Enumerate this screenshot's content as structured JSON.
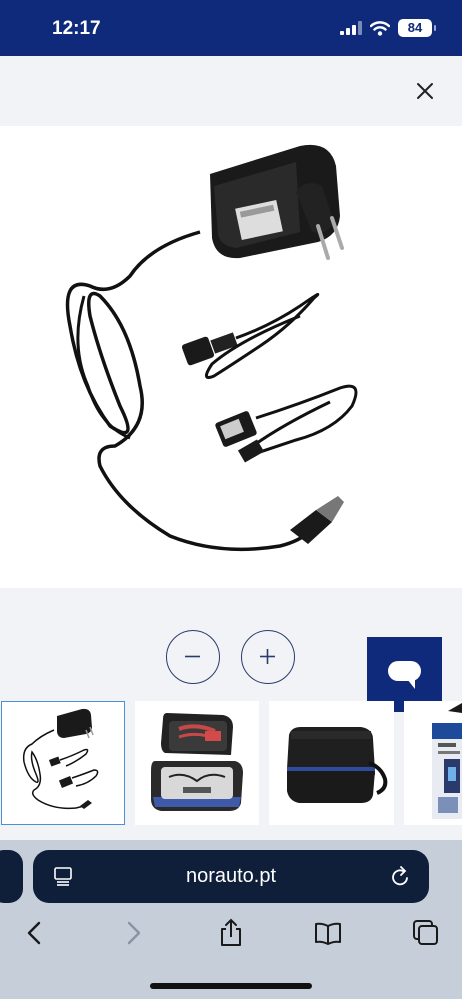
{
  "status_bar": {
    "time": "12:17",
    "battery": "84",
    "icons": [
      "signal-icon",
      "wifi-icon",
      "battery-icon"
    ]
  },
  "modal": {
    "close_icon": "close-icon",
    "zoom_out_icon": "minus-icon",
    "zoom_in_icon": "plus-icon",
    "chat_icon": "chat-icon"
  },
  "thumbnails": [
    {
      "icon": "charger-cables-thumbnail",
      "selected": true
    },
    {
      "icon": "open-case-thumbnail",
      "selected": false
    },
    {
      "icon": "closed-case-thumbnail",
      "selected": false
    },
    {
      "icon": "product-box-thumbnail",
      "selected": false
    }
  ],
  "browser": {
    "url": "norauto.pt",
    "toolbar_icons": [
      "back-icon",
      "forward-icon",
      "share-icon",
      "bookmarks-icon",
      "tabs-icon"
    ]
  },
  "colors": {
    "brand_navy": "#0f2a7a",
    "url_bar": "#0f1f3a",
    "selected_thumb_border": "#4b8fd6"
  }
}
